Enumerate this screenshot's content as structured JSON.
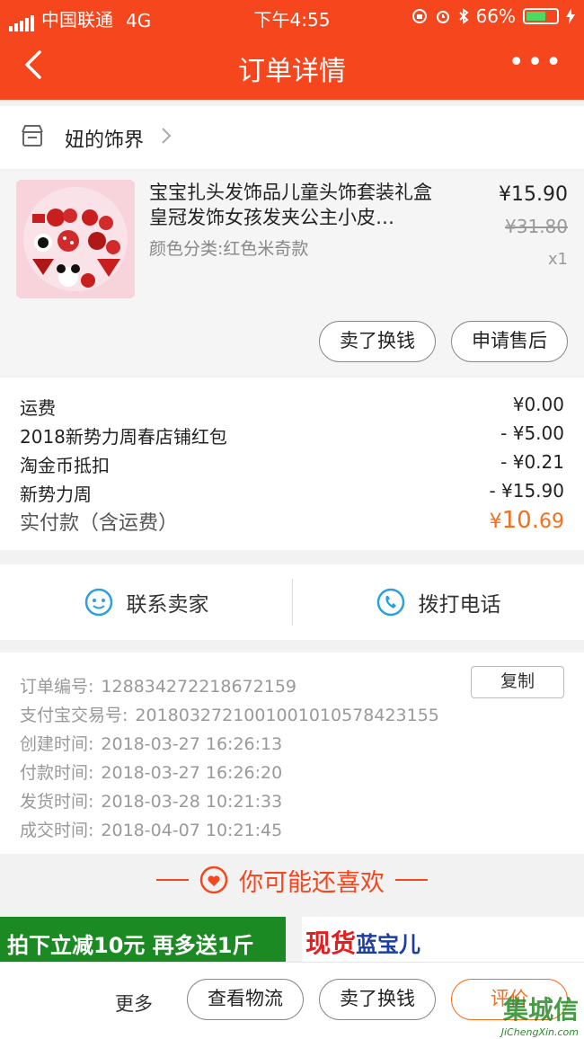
{
  "status_bar": {
    "carrier": "中国联通",
    "network": "4G",
    "time": "下午4:55",
    "battery": "66%",
    "battery_level": 0.66
  },
  "nav": {
    "title": "订单详情",
    "more": "•••"
  },
  "shop": {
    "name": "妞的饰界"
  },
  "product": {
    "title": "宝宝扎头发饰品儿童头饰套装礼盒皇冠发饰女孩发夹公主小皮…",
    "spec": "颜色分类:红色米奇款",
    "price": "¥15.90",
    "original_price": "¥31.80",
    "quantity": "x1",
    "buttons": [
      "卖了换钱",
      "申请售后"
    ]
  },
  "fees": [
    {
      "label": "运费",
      "value": "¥0.00"
    },
    {
      "label": "2018新势力周春店铺红包",
      "value": "- ¥5.00"
    },
    {
      "label": "淘金币抵扣",
      "value": "- ¥0.21"
    },
    {
      "label": "新势力周",
      "value": "- ¥15.90"
    }
  ],
  "total": {
    "label": "实付款（含运费）",
    "currency": "¥",
    "int": "10.",
    "dec": "69"
  },
  "contact": {
    "seller": "联系卖家",
    "call": "拨打电话"
  },
  "order_info": {
    "copy_label": "复制",
    "rows": [
      {
        "label": "订单编号:",
        "value": "128834272218672159"
      },
      {
        "label": "支付宝交易号:",
        "value": "2018032721001001010578423155"
      },
      {
        "label": "创建时间:",
        "value": "2018-03-27 16:26:13"
      },
      {
        "label": "付款时间:",
        "value": "2018-03-27 16:26:20"
      },
      {
        "label": "发货时间:",
        "value": "2018-03-28 10:21:33"
      },
      {
        "label": "成交时间:",
        "value": "2018-04-07 10:21:45"
      }
    ]
  },
  "recommend": {
    "title": "你可能还喜欢"
  },
  "banner": {
    "left": "拍下立减10元 再多送1斤",
    "right_a": "现货",
    "right_b": "蓝宝儿"
  },
  "bottom": {
    "more": "更多",
    "buttons": [
      "查看物流",
      "卖了换钱",
      "评价"
    ]
  },
  "watermark": {
    "cn": "集城信",
    "en": "JiChengXin.com"
  },
  "colors": {
    "brand": "#f5461d",
    "price_accent": "#f56e1b",
    "battery": "#4cd964"
  }
}
